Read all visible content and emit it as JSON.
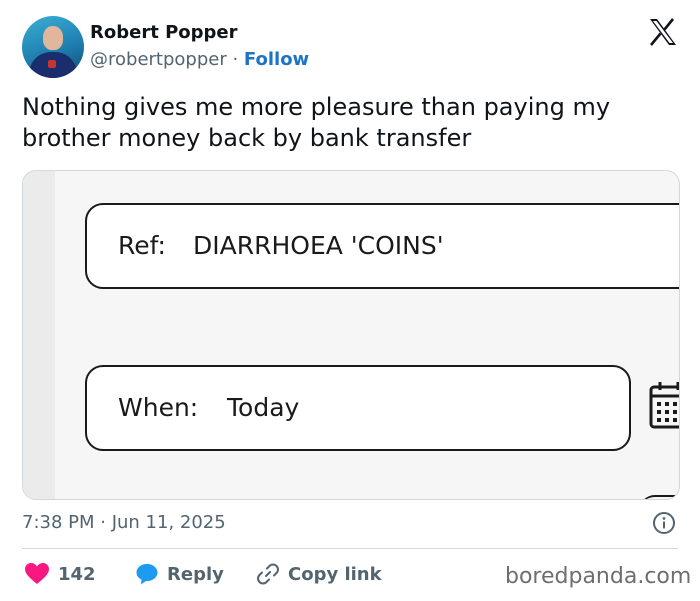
{
  "author": {
    "name": "Robert Popper",
    "handle": "@robertpopper",
    "separator": " · ",
    "follow_label": "Follow"
  },
  "tweet": {
    "text": "Nothing gives me more pleasure than paying my brother money back by bank transfer",
    "timestamp": "7:38 PM · Jun 11, 2025"
  },
  "media": {
    "ref_label": "Ref:",
    "ref_value": "DIARRHOEA 'COINS'",
    "when_label": "When:",
    "when_value": "Today"
  },
  "actions": {
    "like_count": "142",
    "reply_label": "Reply",
    "copy_label": "Copy link"
  },
  "watermark": "boredpanda.com",
  "colors": {
    "like": "#f91880",
    "reply": "#1d9bf0",
    "follow": "#1d74c4",
    "muted": "#536471"
  },
  "icons": [
    "x-logo-icon",
    "heart-icon",
    "reply-bubble-icon",
    "link-icon",
    "info-icon",
    "calendar-icon"
  ]
}
